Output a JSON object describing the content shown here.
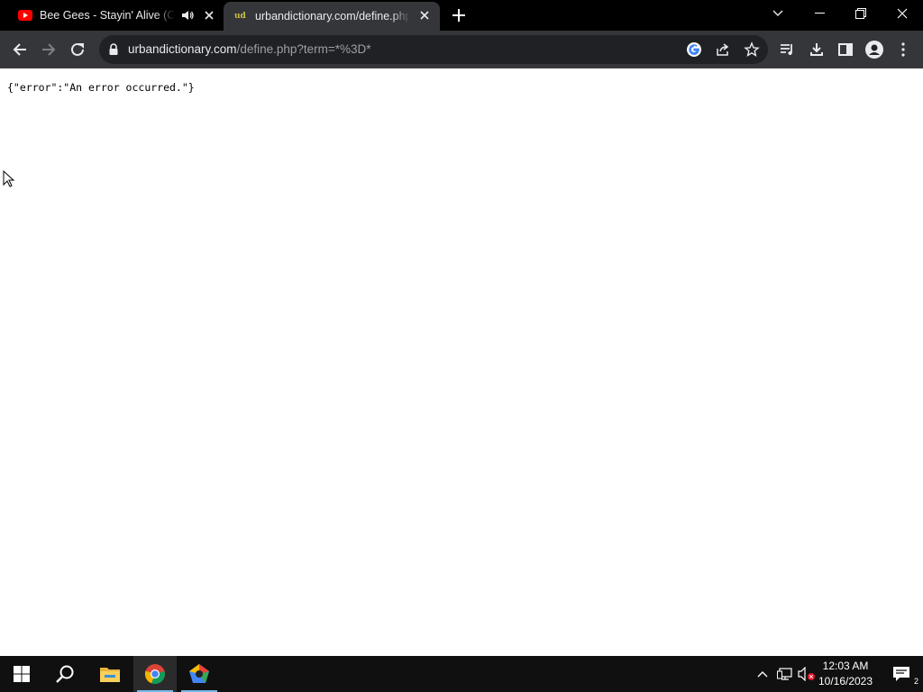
{
  "browser": {
    "tabs": [
      {
        "title": "Bee Gees - Stayin' Alive (Official",
        "favicon": "youtube-icon",
        "audio": true,
        "active": false
      },
      {
        "title": "urbandictionary.com/define.php",
        "favicon": "urban-dictionary-icon",
        "favicon_text": "ud",
        "active": true
      }
    ],
    "address_bar": {
      "host": "urbandictionary.com",
      "path": "/define.php?term=*%3D*"
    }
  },
  "page": {
    "body_text": "{\"error\":\"An error occurred.\"}"
  },
  "taskbar": {
    "pinned": [
      "start-icon",
      "search-icon",
      "file-explorer-icon",
      "chrome-icon",
      "pentagon-app-icon"
    ],
    "clock": {
      "time": "12:03 AM",
      "date": "10/16/2023"
    },
    "notification_count": "2"
  },
  "colors": {
    "tabstrip_bg": "#000000",
    "toolbar_bg": "#35363a",
    "omnibox_bg": "#202124",
    "taskbar_bg": "#101010",
    "youtube_red": "#ff0000"
  }
}
